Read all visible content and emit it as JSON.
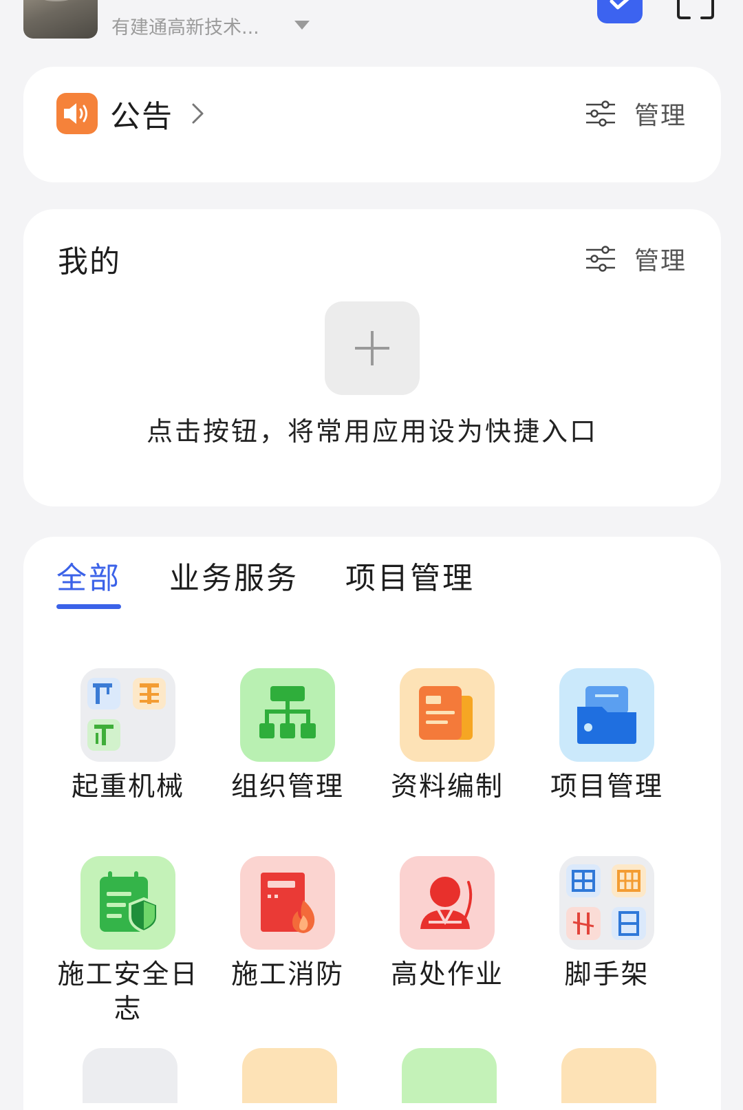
{
  "header": {
    "org_name": "有建通高新技术...",
    "avatar_label": "avatar"
  },
  "notice": {
    "title": "公告",
    "manage_label": "管理"
  },
  "mine": {
    "title": "我的",
    "manage_label": "管理",
    "hint": "点击按钮，将常用应用设为快捷入口"
  },
  "tabs": [
    {
      "label": "全部",
      "active": true
    },
    {
      "label": "业务服务",
      "active": false
    },
    {
      "label": "项目管理",
      "active": false
    }
  ],
  "apps": [
    {
      "label": "起重机械",
      "icon": "crane-icon",
      "color": "#ecedf0"
    },
    {
      "label": "组织管理",
      "icon": "org-chart-icon",
      "color": "#b9f0b2"
    },
    {
      "label": "资料编制",
      "icon": "document-icon",
      "color": "#fde2b6"
    },
    {
      "label": "项目管理",
      "icon": "folder-icon",
      "color": "#cbe9fb"
    },
    {
      "label": "施工安全日志",
      "icon": "safety-log-icon",
      "color": "#c4f2b8"
    },
    {
      "label": "施工消防",
      "icon": "fire-icon",
      "color": "#fbd4d0"
    },
    {
      "label": "高处作业",
      "icon": "worker-icon",
      "color": "#fbd2d0"
    },
    {
      "label": "脚手架",
      "icon": "scaffold-icon",
      "color": "#ecedf0"
    }
  ],
  "colors": {
    "accent": "#3b62e8",
    "notice_icon": "#f5823a"
  }
}
